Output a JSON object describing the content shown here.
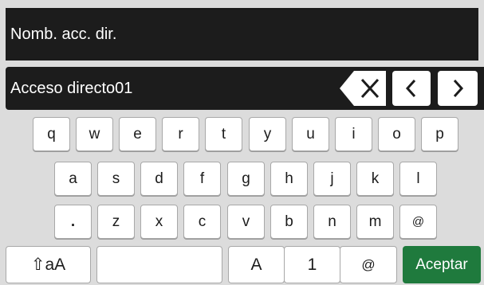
{
  "header": {
    "title": "Nomb. acc. dir."
  },
  "input": {
    "value": "Acceso directo01"
  },
  "controls": {
    "backspace_icon": "backspace-x-icon",
    "left_icon": "chevron-left-icon",
    "right_icon": "chevron-right-icon"
  },
  "keyboard": {
    "row1": [
      "q",
      "w",
      "e",
      "r",
      "t",
      "y",
      "u",
      "i",
      "o",
      "p"
    ],
    "row2": [
      "a",
      "s",
      "d",
      "f",
      "g",
      "h",
      "j",
      "k",
      "l"
    ],
    "row3": [
      ".",
      "z",
      "x",
      "c",
      "v",
      "b",
      "n",
      "m",
      "@"
    ],
    "bottom": {
      "shift_label": "⇧aA",
      "space_label": "",
      "mode_A": "A",
      "mode_1": "1",
      "mode_at": "@",
      "accept": "Aceptar"
    }
  },
  "colors": {
    "accent_accept": "#1f7a3d",
    "bar": "#1c1c1c",
    "background": "#dcdcdc"
  }
}
